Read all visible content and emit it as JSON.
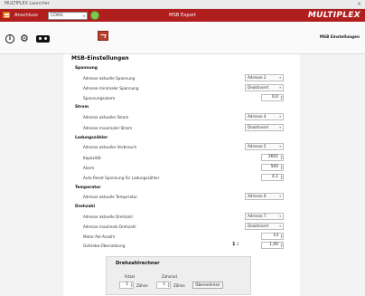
{
  "window": {
    "title": "MULTIPLEX Launcher",
    "close": "×"
  },
  "topbar": {
    "port_label": "Anschluss",
    "port_value": "COM3",
    "center_title": "MSB Export",
    "logo": "MULTIPLEX"
  },
  "toolbar": {
    "breadcrumb": "MSB Einstellungen"
  },
  "main": {
    "heading": "MSB-Einstellungen",
    "spannung": {
      "title": "Spannung",
      "addr_current_label": "Adresse aktuelle Spannung",
      "addr_current_value": "Adresse 2",
      "addr_min_label": "Adresse minimaler Spannung",
      "addr_min_value": "Deaktiviert",
      "alarm_label": "Spannungsalarm",
      "alarm_value": "0,0"
    },
    "strom": {
      "title": "Strom",
      "addr_current_label": "Adresse aktueller Strom",
      "addr_current_value": "Adresse 4",
      "addr_max_label": "Adresse maximaler Strom",
      "addr_max_value": "Deaktiviert"
    },
    "ladung": {
      "title": "Ladungszähler",
      "addr_label": "Adresse aktueller Verbrauch",
      "addr_value": "Adresse 5",
      "capacity_label": "Kapazität",
      "capacity_value": "2601",
      "alarm_label": "Alarm",
      "alarm_value": "500",
      "autoreset_label": "Auto Reset Spannung für Ladungszähler",
      "autoreset_value": "4,1"
    },
    "temperatur": {
      "title": "Temperatur",
      "addr_label": "Adresse aktuelle Temperatur",
      "addr_value": "Adresse 6"
    },
    "drehzahl": {
      "title": "Drehzahl",
      "addr_current_label": "Adresse aktuelle Drehzahl",
      "addr_current_value": "Adresse 7",
      "addr_max_label": "Adresse maximale Drehzahl",
      "addr_max_value": "Deaktiviert",
      "poles_label": "Motor Pol-Anzahl",
      "poles_value": "14",
      "gear_label": "Getriebe-Übersetzung",
      "gear_prefix": "1 :",
      "gear_value": "1,00"
    },
    "rechner": {
      "title": "Drehzahlrechner",
      "ritzel_label": "Ritzel",
      "ritzel_value": "1",
      "ritzel_unit": "Zähne",
      "zahnrad_label": "Zahnrad",
      "zahnrad_value": "1",
      "zahnrad_unit": "Zähne",
      "apply_label": "Übernehmen"
    }
  }
}
